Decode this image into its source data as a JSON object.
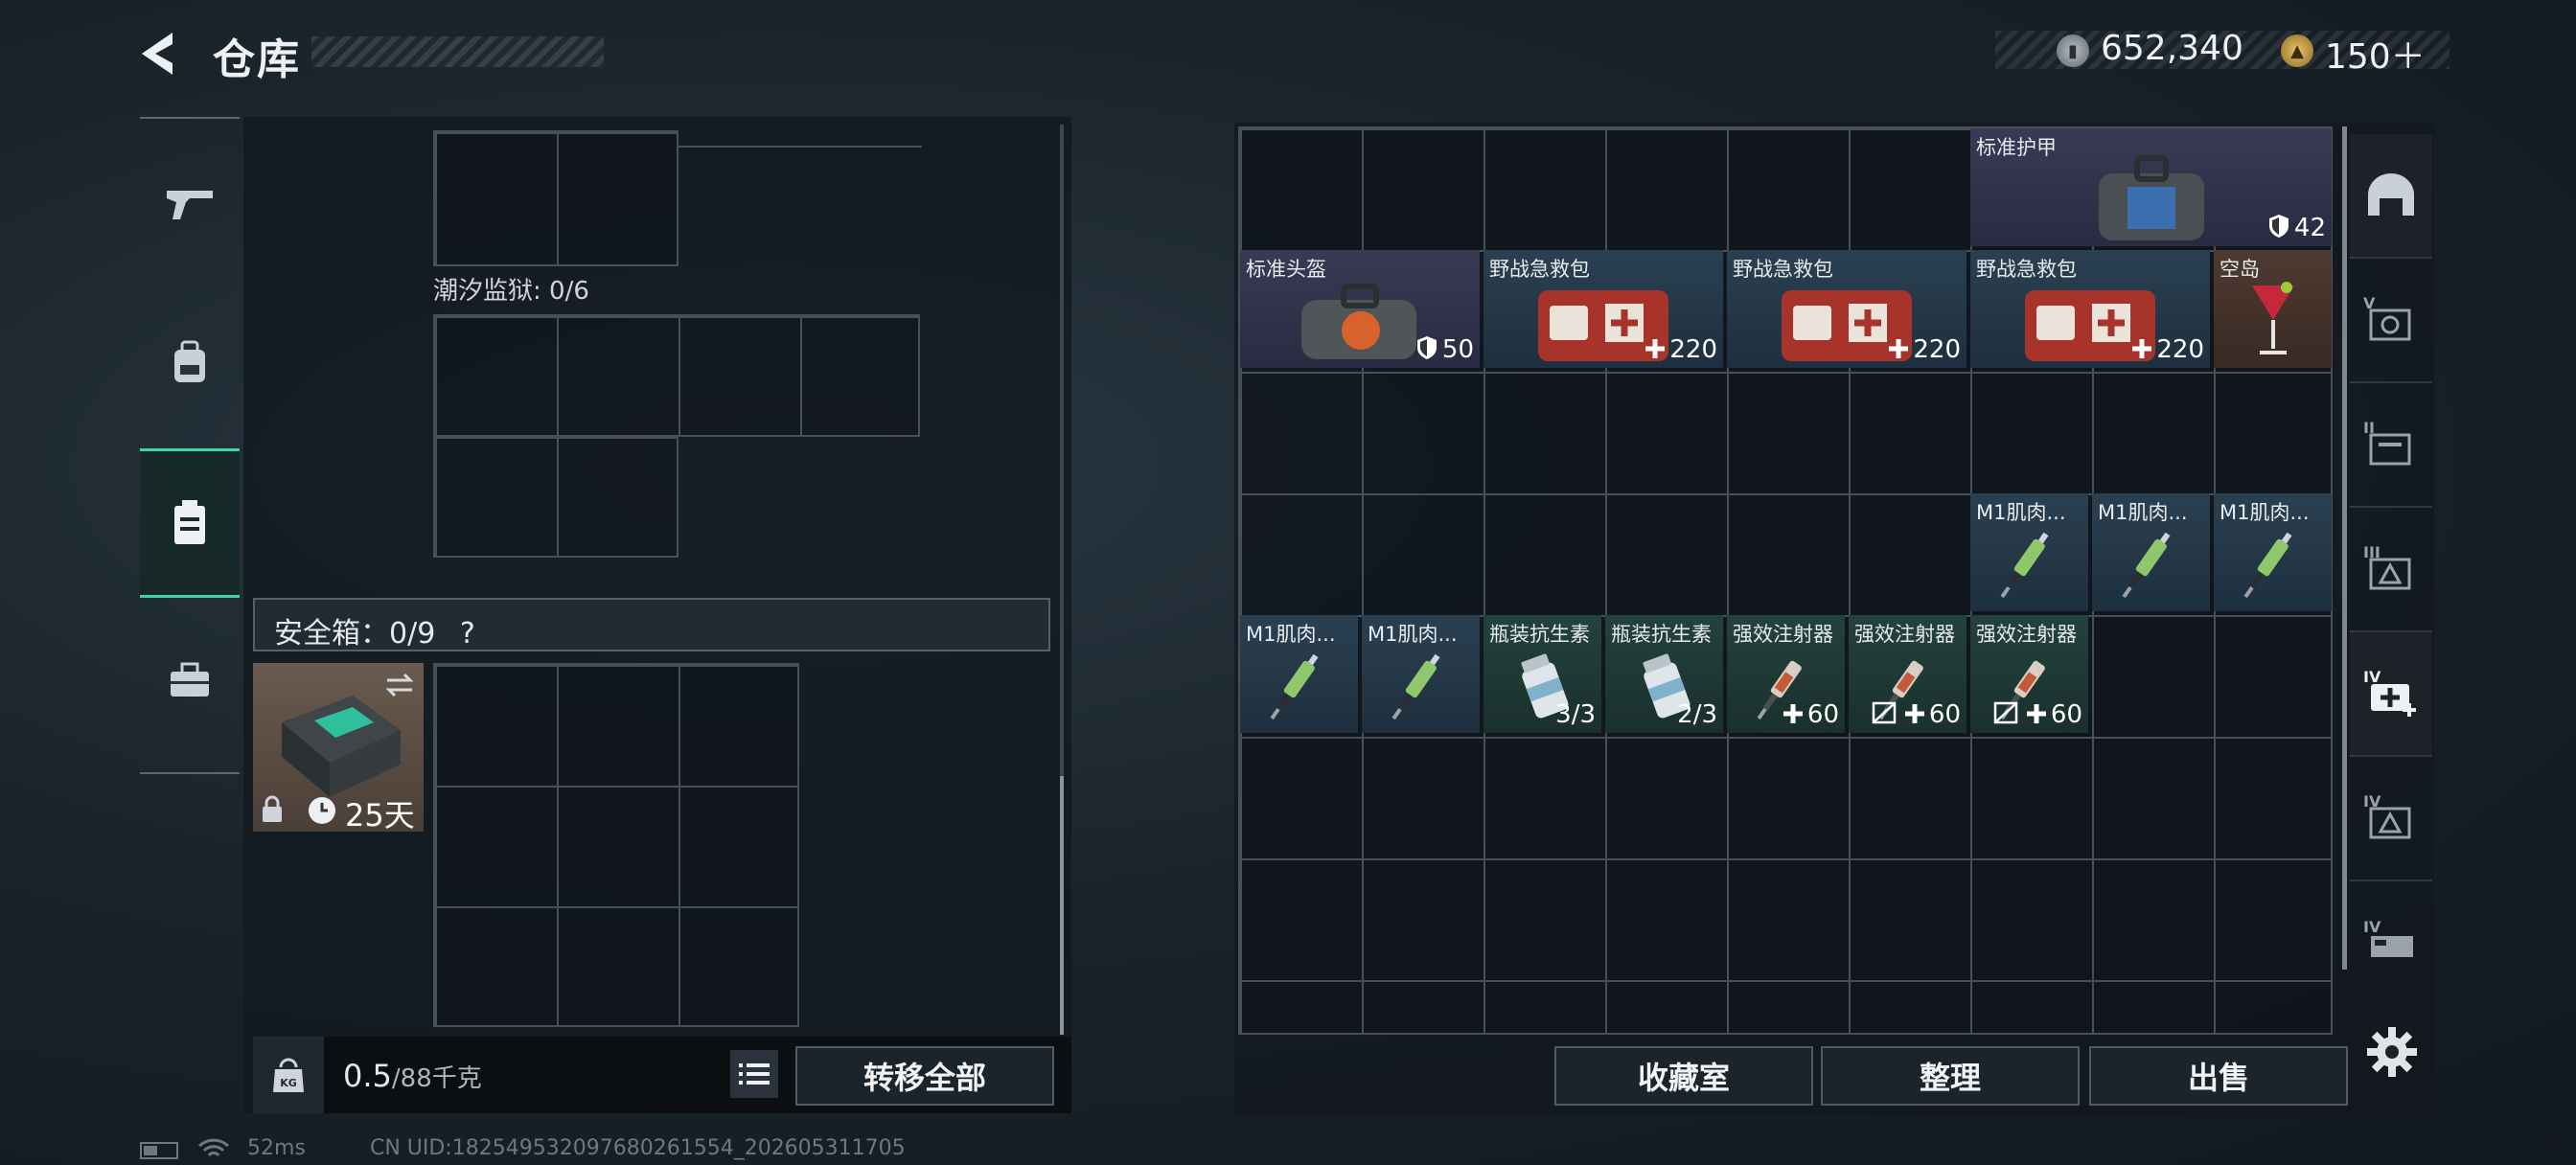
{
  "header": {
    "title": "仓库",
    "currencies": [
      {
        "icon": "silver-coin-icon",
        "amount": "652,340"
      },
      {
        "icon": "gold-coin-icon",
        "amount": "150＋"
      }
    ]
  },
  "left_nav": [
    "gun-icon",
    "backpack-icon",
    "container-icon",
    "toolbox-icon"
  ],
  "left_panel": {
    "tide_prison_label": "潮汐监狱: 0/6",
    "safebox_label": "安全箱：0/9",
    "safebox_help": "?",
    "safebox_item": {
      "days": "25天"
    },
    "weight": {
      "current": "0.5",
      "capacity": "/88千克"
    },
    "transfer_all": "转移全部"
  },
  "stash_items": [
    {
      "name": "标准护甲",
      "stat": "42",
      "stat_icon": "shield-icon",
      "col": 6,
      "row": 0,
      "w": 3,
      "bg": "purple",
      "art": "armor"
    },
    {
      "name": "标准头盔",
      "stat": "50",
      "stat_icon": "shield-icon",
      "col": 0,
      "row": 1,
      "w": 2,
      "bg": "purple",
      "art": "helmet"
    },
    {
      "name": "野战急救包",
      "stat": "220",
      "stat_icon": "plus-icon",
      "col": 2,
      "row": 1,
      "w": 2,
      "bg": "blue",
      "art": "medkit"
    },
    {
      "name": "野战急救包",
      "stat": "220",
      "stat_icon": "plus-icon",
      "col": 4,
      "row": 1,
      "w": 2,
      "bg": "blue",
      "art": "medkit"
    },
    {
      "name": "野战急救包",
      "stat": "220",
      "stat_icon": "plus-icon",
      "col": 6,
      "row": 1,
      "w": 2,
      "bg": "blue",
      "art": "medkit"
    },
    {
      "name": "空岛",
      "stat": "",
      "stat_icon": "",
      "col": 8,
      "row": 1,
      "w": 1,
      "bg": "brown",
      "art": "cocktail"
    },
    {
      "name": "M1肌肉...",
      "stat": "",
      "stat_icon": "",
      "col": 6,
      "row": 3,
      "w": 1,
      "bg": "blue",
      "art": "syringe-green"
    },
    {
      "name": "M1肌肉...",
      "stat": "",
      "stat_icon": "",
      "col": 7,
      "row": 3,
      "w": 1,
      "bg": "blue",
      "art": "syringe-green"
    },
    {
      "name": "M1肌肉...",
      "stat": "",
      "stat_icon": "",
      "col": 8,
      "row": 3,
      "w": 1,
      "bg": "blue",
      "art": "syringe-green"
    },
    {
      "name": "M1肌肉...",
      "stat": "",
      "stat_icon": "",
      "col": 0,
      "row": 4,
      "w": 1,
      "bg": "blue",
      "art": "syringe-green"
    },
    {
      "name": "M1肌肉...",
      "stat": "",
      "stat_icon": "",
      "col": 1,
      "row": 4,
      "w": 1,
      "bg": "blue",
      "art": "syringe-green"
    },
    {
      "name": "瓶装抗生素",
      "stat": "3/3",
      "stat_icon": "",
      "col": 2,
      "row": 4,
      "w": 1,
      "bg": "teal",
      "art": "bottle"
    },
    {
      "name": "瓶装抗生素",
      "stat": "2/3",
      "stat_icon": "",
      "col": 3,
      "row": 4,
      "w": 1,
      "bg": "teal",
      "art": "bottle"
    },
    {
      "name": "强效注射器",
      "stat": "60",
      "stat_icon": "plus-icon",
      "col": 4,
      "row": 4,
      "w": 1,
      "bg": "teal",
      "art": "syringe-red"
    },
    {
      "name": "强效注射器",
      "stat": "60",
      "stat_icon": "plus-icon",
      "extra_icon": "no-insure-icon",
      "col": 5,
      "row": 4,
      "w": 1,
      "bg": "teal",
      "art": "syringe-red"
    },
    {
      "name": "强效注射器",
      "stat": "60",
      "stat_icon": "plus-icon",
      "extra_icon": "no-insure-icon",
      "col": 6,
      "row": 4,
      "w": 1,
      "bg": "teal",
      "art": "syringe-red"
    }
  ],
  "right_sidebar": [
    "helmet-tab-icon",
    "V",
    "II",
    "III",
    "IV",
    "IV",
    "IV"
  ],
  "bottom_right": {
    "vault": "收藏室",
    "sort": "整理",
    "sell": "出售"
  },
  "status": {
    "ping": "52ms",
    "uid": "CN UID:182549532097680261554_202605311705"
  }
}
